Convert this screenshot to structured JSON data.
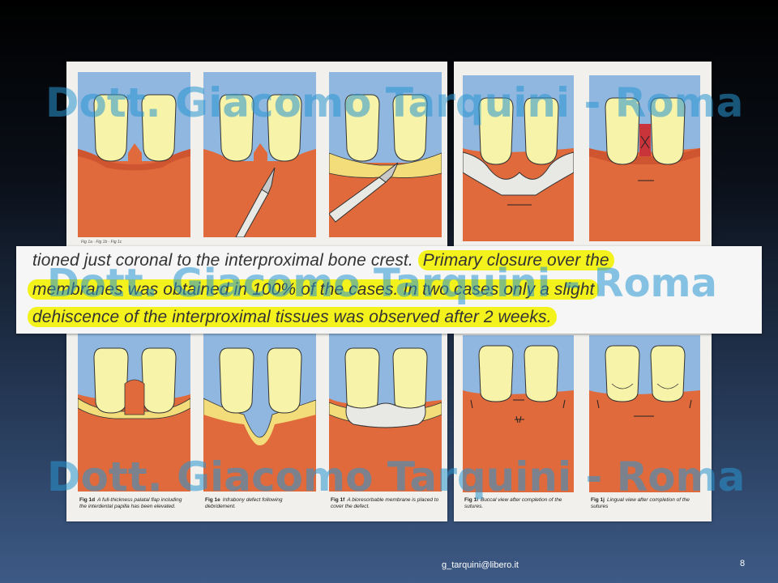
{
  "quote": {
    "line1_plain": "tioned just coronal to the interproximal bone crest.",
    "line1_highlight": "Primary closure over the",
    "line2_highlight": "membranes was obtained in 100% of the cases. In two cases only a slight",
    "line3_highlight": "dehiscence of the interproximal tissues was observed after 2 weeks."
  },
  "figures": [
    {
      "label": "Fig 1d",
      "text": "A full-thickness palatal flap including the interdental papilla has been elevated."
    },
    {
      "label": "Fig 1e",
      "text": "Infrabony defect following debridement."
    },
    {
      "label": "Fig 1f",
      "text": "A bioresorbable membrane is placed to cover the defect."
    },
    {
      "label": "Fig 1i",
      "text": "Buccal view after completion of the sutures."
    },
    {
      "label": "Fig 1j",
      "text": "Lingual view after completion of the sutures"
    }
  ],
  "watermark": "Dott. Giacomo Tarquini - Roma",
  "footer": {
    "email": "g_tarquini@libero.it",
    "page_number": "8"
  },
  "colors": {
    "sky": "#8fb7e0",
    "tooth": "#f7f3a8",
    "gum": "#e06a3c",
    "gum_dark": "#cf5530",
    "membrane": "#e8e8e4",
    "highlight": "#f4f21c",
    "watermark": "#2896d2"
  }
}
